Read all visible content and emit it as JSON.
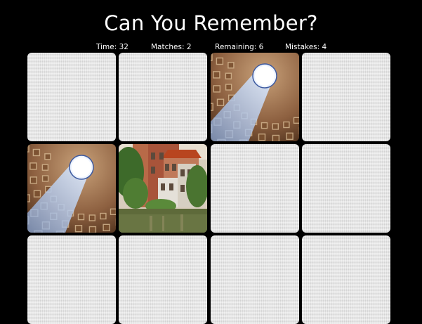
{
  "game": {
    "title": "Can You Remember?"
  },
  "stats": {
    "time": "Time: 32",
    "matches": "Matches: 2",
    "remaining": "Remaining: 6",
    "mistakes": "Mistakes: 4"
  },
  "cards": [
    {
      "state": "face-down"
    },
    {
      "state": "face-down"
    },
    {
      "state": "face-up",
      "image": "pantheon-dome"
    },
    {
      "state": "face-down"
    },
    {
      "state": "face-up",
      "image": "pantheon-dome"
    },
    {
      "state": "face-up",
      "image": "canal-houses"
    },
    {
      "state": "face-down"
    },
    {
      "state": "face-down"
    },
    {
      "state": "face-down"
    },
    {
      "state": "face-down"
    },
    {
      "state": "face-down"
    },
    {
      "state": "face-down"
    }
  ],
  "colors": {
    "background": "#000000",
    "card_back": "#e2e2e2",
    "text": "#ffffff"
  }
}
